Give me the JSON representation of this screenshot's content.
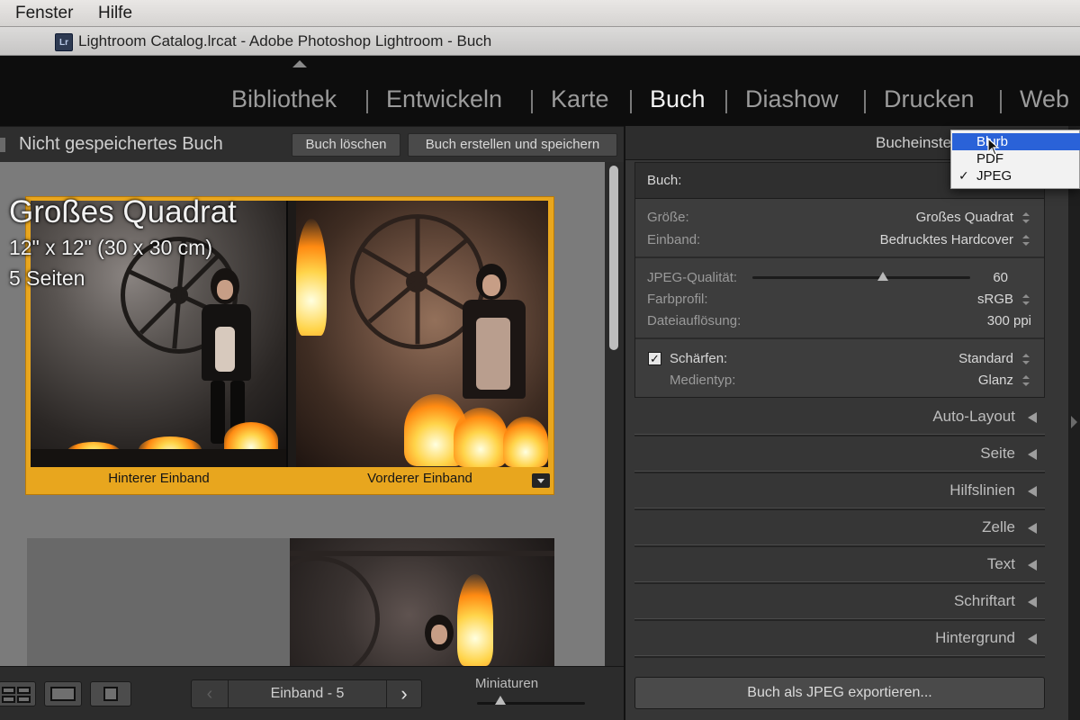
{
  "menubar": {
    "items": [
      "Fenster",
      "Hilfe"
    ]
  },
  "window": {
    "app_icon": "Lr",
    "title": "Lightroom Catalog.lrcat - Adobe Photoshop Lightroom - Buch"
  },
  "modules": {
    "tabs": [
      {
        "label": "Bibliothek",
        "active": false
      },
      {
        "label": "Entwickeln",
        "active": false
      },
      {
        "label": "Karte",
        "active": false
      },
      {
        "label": "Buch",
        "active": true
      },
      {
        "label": "Diashow",
        "active": false
      },
      {
        "label": "Drucken",
        "active": false
      },
      {
        "label": "Web",
        "active": false
      }
    ]
  },
  "book_header": {
    "name": "Nicht gespeichertes Buch",
    "delete_label": "Buch löschen",
    "create_label": "Buch erstellen und speichern"
  },
  "canvas": {
    "overlay_title": "Großes Quadrat",
    "overlay_size": "12\" x 12\" (30 x 30 cm)",
    "overlay_pages": "5 Seiten",
    "back_cover_label": "Hinterer Einband",
    "front_cover_label": "Vorderer Einband"
  },
  "toolbar": {
    "pager_label": "Einband - 5",
    "prev_icon": "chevron-left-icon",
    "next_icon": "chevron-right-icon",
    "next_glyph": "›",
    "prev_glyph": "‹",
    "thumbnails_label": "Miniaturen",
    "thumbnail_size": 0.22
  },
  "right_panel": {
    "header_title": "Bucheinste",
    "book_label": "Buch:",
    "size_label": "Größe:",
    "size_value": "Großes Quadrat",
    "binding_label": "Einband:",
    "binding_value": "Bedrucktes Hardcover",
    "jpeg_quality_label": "JPEG-Qualität:",
    "jpeg_quality_value": "60",
    "jpeg_quality_fraction": 0.6,
    "color_profile_label": "Farbprofil:",
    "color_profile_value": "sRGB",
    "file_resolution_label": "Dateiauflösung:",
    "file_resolution_value": "300 ppi",
    "sharpen_label": "Schärfen:",
    "sharpen_checked": true,
    "sharpen_value": "Standard",
    "media_type_label": "Medientyp:",
    "media_type_value": "Glanz",
    "sections": [
      "Auto-Layout",
      "Seite",
      "Hilfslinien",
      "Zelle",
      "Text",
      "Schriftart",
      "Hintergrund"
    ],
    "export_label": "Buch als JPEG exportieren..."
  },
  "popup": {
    "items": [
      {
        "label": "Blurb",
        "highlighted": true,
        "checked": false
      },
      {
        "label": "PDF",
        "highlighted": false,
        "checked": false
      },
      {
        "label": "JPEG",
        "highlighted": false,
        "checked": true
      }
    ],
    "check_glyph": "✓"
  },
  "colors": {
    "accent_selection": "#e8a61e",
    "menu_highlight": "#2a62d8",
    "panel_bg": "#363636",
    "module_active": "#f2f2f2",
    "module_inactive": "#9b9b9b"
  }
}
